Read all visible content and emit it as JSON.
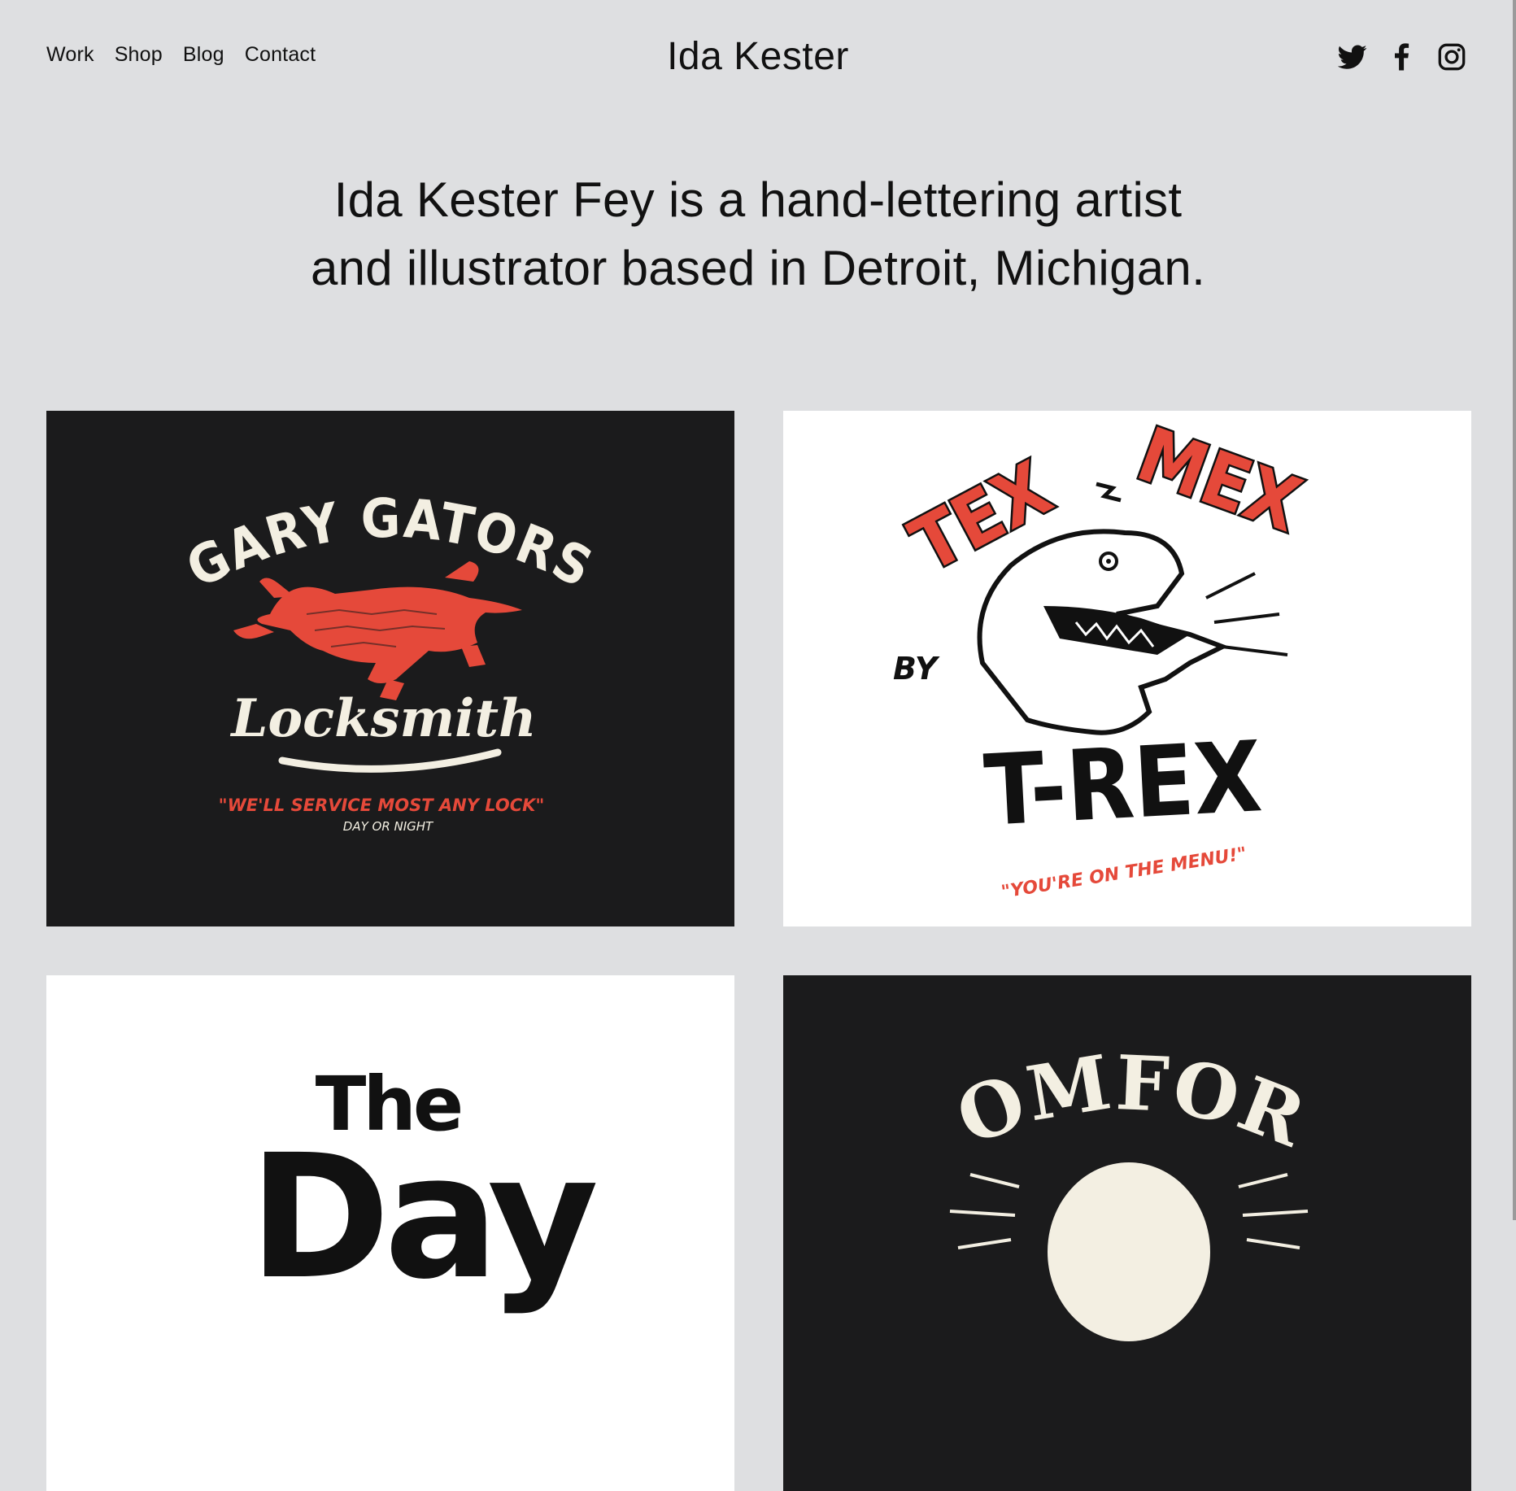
{
  "nav": {
    "items": [
      {
        "label": "Work"
      },
      {
        "label": "Shop"
      },
      {
        "label": "Blog"
      },
      {
        "label": "Contact"
      }
    ]
  },
  "header": {
    "title": "Ida Kester"
  },
  "social": [
    {
      "icon": "twitter-icon"
    },
    {
      "icon": "facebook-icon"
    },
    {
      "icon": "instagram-icon"
    }
  ],
  "intro": {
    "line1": "Ida Kester Fey is a hand-lettering artist",
    "line2": "and illustrator based in Detroit, Michigan."
  },
  "colors": {
    "background": "#dedfe1",
    "accent_red": "#e5493a",
    "cream": "#f3efe2",
    "dark": "#1b1b1c"
  },
  "projects": [
    {
      "name": "gary-gators",
      "top": "GARY GATORS",
      "script": "Locksmith",
      "quote": "\"WE'LL SERVICE MOST ANY LOCK\"",
      "sub": "DAY OR NIGHT"
    },
    {
      "name": "tex-mex",
      "left": "TEX",
      "right": "MEX",
      "by": "BY",
      "main": "T-REX",
      "quote": "\"YOU'RE ON THE MENU!\""
    },
    {
      "name": "the-day",
      "small": "The",
      "big": "Day"
    },
    {
      "name": "comfort",
      "top": "COMFORT"
    }
  ]
}
